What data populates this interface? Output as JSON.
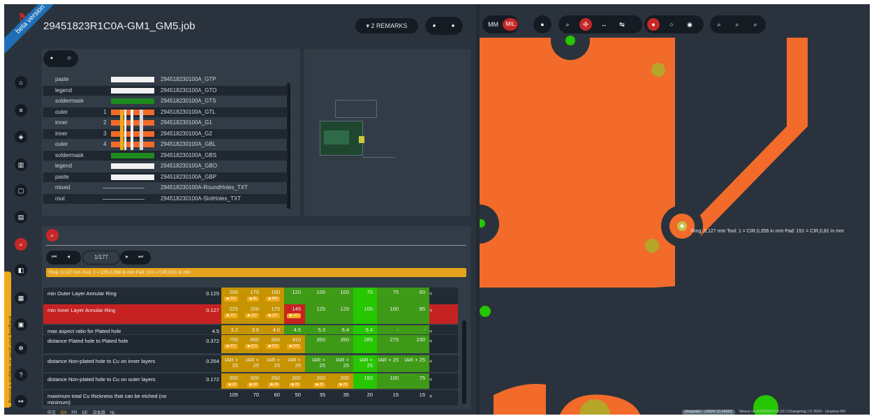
{
  "header": {
    "beta_label": "beta version",
    "job_title": "29451823R1C0A-GM1_GM5.job",
    "remarks_label": "▾ 2 REMARKS"
  },
  "toolbar": {
    "mm": "MM",
    "mil": "MIL"
  },
  "layers": [
    {
      "type": "paste",
      "num": "",
      "name": "294518230100A_GTP",
      "color": "#f2f2f2"
    },
    {
      "type": "legend",
      "num": "",
      "name": "294518230100A_GTO",
      "color": "#f2f2f2"
    },
    {
      "type": "soldermask",
      "num": "",
      "name": "294518230100A_GTS",
      "color": "#1e8a1e"
    },
    {
      "type": "outer",
      "num": "1",
      "name": "294518230100A_GTL",
      "color": "#f26b2a"
    },
    {
      "type": "inner",
      "num": "2",
      "name": "294518230100A_G1",
      "color": "#f26b2a"
    },
    {
      "type": "inner",
      "num": "3",
      "name": "294518230100A_G2",
      "color": "#f26b2a"
    },
    {
      "type": "outer",
      "num": "4",
      "name": "294518230100A_GBL",
      "color": "#f26b2a"
    },
    {
      "type": "soldermask",
      "num": "",
      "name": "294518230100A_GBS",
      "color": "#1e8a1e"
    },
    {
      "type": "legend",
      "num": "",
      "name": "294518230100A_GBO",
      "color": "#f2f2f2"
    },
    {
      "type": "paste",
      "num": "",
      "name": "294518230100A_GBP",
      "color": "#f2f2f2"
    },
    {
      "type": "mixed",
      "num": "",
      "name": "294518230100A-RoundHoles_TXT",
      "color": ""
    },
    {
      "type": "rout",
      "num": "",
      "name": "294518230100A-SlotHoles_TXT",
      "color": ""
    }
  ],
  "pager": {
    "page": "1/177"
  },
  "info_text": "Ring: 0,127 mm Tool: 1 = CIR,0,356 in mm Pad: 151 = CIR,0,81 in mm",
  "canvas_label": "Ring: 0,127 mm Tool: 1 = CIR,0,356 in mm Pad: 151 = CIR,0,81 in mm",
  "rules": [
    {
      "name": "min Outer Layer Annular Ring",
      "value": "0.125",
      "cells": [
        "200",
        "175",
        "150",
        "120",
        "100",
        "100",
        "75",
        "75",
        "60"
      ],
      "badges": [
        "202",
        "85",
        "883",
        "",
        "",
        "",
        "",
        "",
        ""
      ],
      "colors": [
        "y",
        "y",
        "y",
        "g",
        "g",
        "g",
        "gb",
        "g",
        "g"
      ],
      "hl": false
    },
    {
      "name": "min Inner Layer Annular Ring",
      "value": "0.127",
      "cells": [
        "225",
        "200",
        "175",
        "145",
        "125",
        "125",
        "100",
        "100",
        "85"
      ],
      "badges": [
        "127",
        "127",
        "127",
        "127",
        "",
        "",
        "",
        "",
        ""
      ],
      "colors": [
        "y",
        "y",
        "y",
        "r",
        "g",
        "g",
        "gb",
        "g",
        "g"
      ],
      "hl": true
    },
    {
      "name": "max aspect ratio for Plated hole",
      "value": "4.5",
      "cells": [
        "3.2",
        "3.6",
        "4.0",
        "4.6",
        "5.3",
        "6.4",
        "6.4",
        "-",
        "-"
      ],
      "badges": [
        "",
        "",
        "",
        "",
        "",
        "",
        "",
        "",
        ""
      ],
      "colors": [
        "y",
        "y",
        "y",
        "g",
        "g",
        "g",
        "gb",
        "g",
        "g"
      ],
      "hl": false
    },
    {
      "name": "distance Plated hole to Plated hole",
      "value": "0.372",
      "cells": [
        "750",
        "600",
        "500",
        "410",
        "350",
        "350",
        "285",
        "275",
        "230"
      ],
      "badges": [
        "372",
        "372",
        "372",
        "372",
        "",
        "",
        "",
        "",
        ""
      ],
      "colors": [
        "y",
        "y",
        "y",
        "y",
        "g",
        "g",
        "gb",
        "g",
        "g"
      ],
      "hl": false
    },
    {
      "name": "distance Non-plated hole to Cu on inner layers",
      "value": "0.254",
      "cells": [
        "IAR + 25",
        "IAR + 25",
        "IAR + 25",
        "IAR + 25",
        "IAR + 25",
        "IAR + 25",
        "IAR + 25",
        "IAR + 25",
        "IAR + 25"
      ],
      "badges": [
        "",
        "",
        "",
        "",
        "",
        "",
        "",
        "",
        ""
      ],
      "colors": [
        "y",
        "y",
        "y",
        "y",
        "g",
        "g",
        "gb",
        "g",
        "g"
      ],
      "hl": false
    },
    {
      "name": "distance Non-plated hole to Cu on outer layers",
      "value": "0.172",
      "cells": [
        "350",
        "300",
        "250",
        "200",
        "200",
        "200",
        "150",
        "100",
        "75"
      ],
      "badges": [
        "28",
        "28",
        "28",
        "28",
        "28",
        "28",
        "",
        "",
        ""
      ],
      "colors": [
        "y",
        "y",
        "y",
        "y",
        "y",
        "y",
        "gb",
        "g",
        "g"
      ],
      "hl": false
    },
    {
      "name": "maximum total Cu thickness that can be etched (no minimum)",
      "value": "",
      "cells": [
        "105",
        "70",
        "60",
        "50",
        "35",
        "35",
        "20",
        "15",
        "15"
      ],
      "badges": [
        "",
        "",
        "",
        "",
        "",
        "",
        "",
        "",
        ""
      ],
      "colors": [
        "n",
        "n",
        "n",
        "n",
        "n",
        "n",
        "n",
        "n",
        "n"
      ],
      "hl": false
    }
  ],
  "feedback_text": "Report a problem or send your feedback",
  "languages": [
    "中文",
    "EN",
    "FR",
    "DE",
    "日本語",
    "NL"
  ],
  "footer": {
    "version_badge": "integrator - v2024.10-24502",
    "version_text": "Nexus v2-4/10/2024-16:23 | Changelog | © 2024 - Ucamco NV"
  },
  "colors": {
    "yellow": "#c79300",
    "green": "#3f9a17",
    "green_bright": "#26c600",
    "red": "#c62222",
    "copper": "#f26b2a"
  }
}
